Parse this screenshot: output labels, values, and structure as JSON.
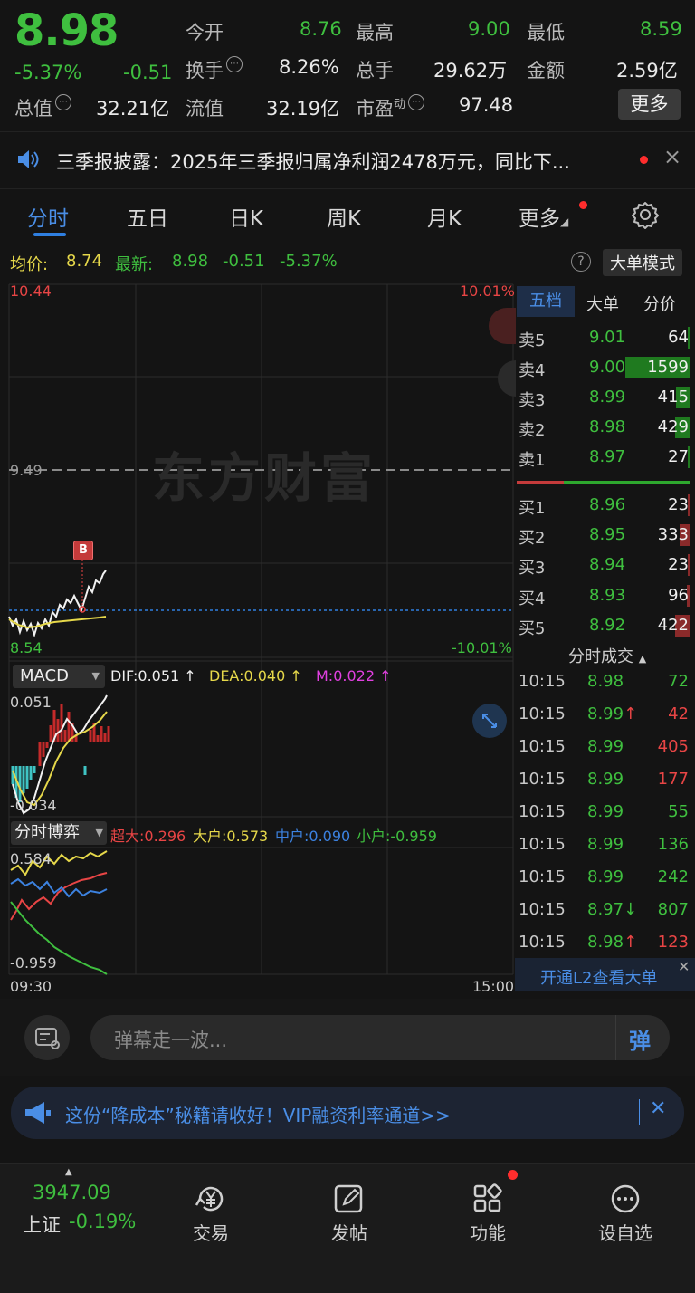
{
  "quote": {
    "price": "8.98",
    "change_pct": "-5.37%",
    "change": "-0.51",
    "open_label": "今开",
    "open": "8.76",
    "high_label": "最高",
    "high": "9.00",
    "low_label": "最低",
    "low": "8.59",
    "turnover_label": "换手",
    "turnover": "8.26%",
    "volume_label": "总手",
    "volume": "29.62万",
    "amount_label": "金额",
    "amount": "2.59亿",
    "mktcap_label": "总值",
    "mktcap": "32.21亿",
    "float_label": "流值",
    "float": "32.19亿",
    "pe_label": "市盈",
    "pe_sup": "动",
    "pe": "97.48",
    "more_label": "更多"
  },
  "news": {
    "text": "三季报披露：2025年三季报归属净利润2478万元，同比下...",
    "close": "×"
  },
  "tabs": [
    {
      "label": "分时"
    },
    {
      "label": "五日"
    },
    {
      "label": "日K"
    },
    {
      "label": "周K"
    },
    {
      "label": "月K"
    },
    {
      "label": "更多"
    }
  ],
  "statline": {
    "avg_label": "均价:",
    "avg": "8.74",
    "latest_label": "最新:",
    "latest": "8.98",
    "chg": "-0.51",
    "chg_pct": "-5.37%",
    "mode_label": "大单模式"
  },
  "chart": {
    "y_top": "10.44",
    "y_top_pct": "10.01%",
    "y_mid": "9.49",
    "y_bot": "8.54",
    "y_bot_pct": "-10.01%",
    "watermark": "东方财富",
    "buy_marker": "B",
    "t_start": "09:30",
    "t_end": "15:00"
  },
  "macd": {
    "label": "MACD",
    "dif": "DIF:0.051",
    "dea": "DEA:0.040",
    "m": "M:0.022",
    "y_top": "0.051",
    "y_bot": "-0.034"
  },
  "boyi": {
    "label": "分时博弈",
    "super": "超大:0.296",
    "big": "大户:0.573",
    "mid": "中户:0.090",
    "small": "小户:-0.959",
    "y_top": "0.584",
    "y_bot": "-0.959"
  },
  "orderbook": {
    "tabs": [
      "五档",
      "大单",
      "分价"
    ],
    "asks": [
      {
        "name": "卖5",
        "price": "9.01",
        "vol": "64",
        "frac": 0.02
      },
      {
        "name": "卖4",
        "price": "9.00",
        "vol": "1599",
        "frac": 0.6
      },
      {
        "name": "卖3",
        "price": "8.99",
        "vol": "415",
        "frac": 0.13
      },
      {
        "name": "卖2",
        "price": "8.98",
        "vol": "429",
        "frac": 0.14
      },
      {
        "name": "卖1",
        "price": "8.97",
        "vol": "27",
        "frac": 0.01
      }
    ],
    "bids": [
      {
        "name": "买1",
        "price": "8.96",
        "vol": "23",
        "frac": 0.01
      },
      {
        "name": "买2",
        "price": "8.95",
        "vol": "333",
        "frac": 0.1
      },
      {
        "name": "买3",
        "price": "8.94",
        "vol": "23",
        "frac": 0.01
      },
      {
        "name": "买4",
        "price": "8.93",
        "vol": "96",
        "frac": 0.03
      },
      {
        "name": "买5",
        "price": "8.92",
        "vol": "422",
        "frac": 0.14
      }
    ],
    "trades_label": "分时成交",
    "trades": [
      {
        "time": "10:15",
        "price": "8.98",
        "arrow": "",
        "vol": "72",
        "side": "sell"
      },
      {
        "time": "10:15",
        "price": "8.99",
        "arrow": "↑",
        "vol": "42",
        "side": "buy"
      },
      {
        "time": "10:15",
        "price": "8.99",
        "arrow": "",
        "vol": "405",
        "side": "buy"
      },
      {
        "time": "10:15",
        "price": "8.99",
        "arrow": "",
        "vol": "177",
        "side": "buy"
      },
      {
        "time": "10:15",
        "price": "8.99",
        "arrow": "",
        "vol": "55",
        "side": "sell"
      },
      {
        "time": "10:15",
        "price": "8.99",
        "arrow": "",
        "vol": "136",
        "side": "sell"
      },
      {
        "time": "10:15",
        "price": "8.99",
        "arrow": "",
        "vol": "242",
        "side": "sell"
      },
      {
        "time": "10:15",
        "price": "8.97",
        "arrow": "↓",
        "vol": "807",
        "side": "sell"
      },
      {
        "time": "10:15",
        "price": "8.98",
        "arrow": "↑",
        "vol": "123",
        "side": "buy"
      }
    ],
    "l2_label": "开通L2查看大单"
  },
  "comment": {
    "placeholder": "弹幕走一波...",
    "danmu": "弹"
  },
  "ad": {
    "text": "这份“降成本”秘籍请收好！VIP融资利率通道>>"
  },
  "bottom": {
    "index_value": "3947.09",
    "index_name": "上证",
    "index_chg": "-0.19%",
    "trade": "交易",
    "post": "发帖",
    "func": "功能",
    "watch": "设自选"
  },
  "colors": {
    "up": "#e84545",
    "down": "#3fbf3f",
    "accent": "#2f7fe0",
    "avg_line": "#e6d84a"
  }
}
